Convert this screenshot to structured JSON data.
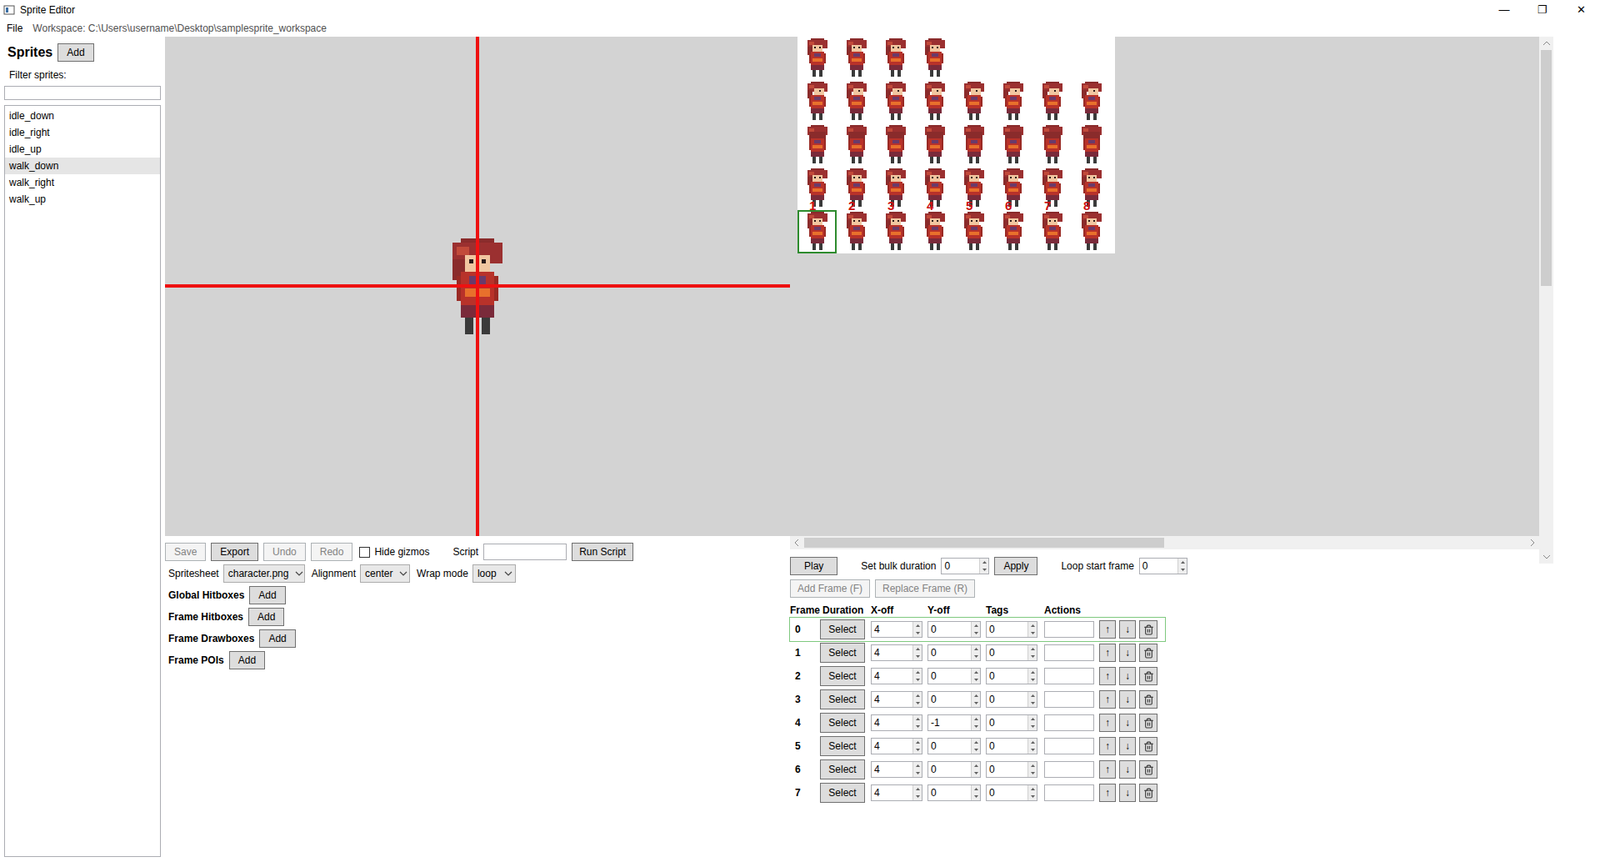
{
  "window": {
    "title": "Sprite Editor",
    "controls": [
      "—",
      "❐",
      "✕"
    ]
  },
  "menu": {
    "items": [
      "File"
    ],
    "workspace": "Workspace: C:\\Users\\username\\Desktop\\samplesprite_workspace"
  },
  "sidebar": {
    "title": "Sprites",
    "add": "Add",
    "filter_label": "Filter sprites:",
    "filter_value": "",
    "items": [
      {
        "label": "idle_down",
        "selected": false
      },
      {
        "label": "idle_right",
        "selected": false
      },
      {
        "label": "idle_up",
        "selected": false
      },
      {
        "label": "walk_down",
        "selected": true
      },
      {
        "label": "walk_right",
        "selected": false
      },
      {
        "label": "walk_up",
        "selected": false
      }
    ]
  },
  "toolbar": {
    "buttons": [
      {
        "label": "Save",
        "disabled": true
      },
      {
        "label": "Export",
        "disabled": false
      },
      {
        "label": "Undo",
        "disabled": true
      },
      {
        "label": "Redo",
        "disabled": true
      }
    ],
    "hide_gizmos": {
      "label": "Hide gizmos",
      "checked": false
    },
    "script": {
      "label": "Script",
      "value": ""
    },
    "run": "Run Script"
  },
  "settings": [
    {
      "label": "Spritesheet",
      "value": "character.png"
    },
    {
      "label": "Alignment",
      "value": "center"
    },
    {
      "label": "Wrap mode",
      "value": "loop"
    }
  ],
  "sections": [
    {
      "label": "Global Hitboxes",
      "button": "Add"
    },
    {
      "label": "Frame Hitboxes",
      "button": "Add"
    },
    {
      "label": "Frame Drawboxes",
      "button": "Add"
    },
    {
      "label": "Frame POIs",
      "button": "Add"
    }
  ],
  "sheet": {
    "rows": [
      {
        "cells": [
          {
            "label": "",
            "selected": false
          },
          {
            "label": "",
            "selected": false
          },
          {
            "label": "",
            "selected": false
          },
          {
            "label": "",
            "selected": false
          }
        ]
      },
      {
        "cells": [
          {
            "label": "",
            "selected": false
          },
          {
            "label": "",
            "selected": false
          },
          {
            "label": "",
            "selected": false
          },
          {
            "label": "",
            "selected": false
          },
          {
            "label": "",
            "selected": false
          },
          {
            "label": "",
            "selected": false
          },
          {
            "label": "",
            "selected": false
          },
          {
            "label": "",
            "selected": false
          }
        ]
      },
      {
        "cells": [
          {
            "label": "",
            "selected": false
          },
          {
            "label": "",
            "selected": false
          },
          {
            "label": "",
            "selected": false
          },
          {
            "label": "",
            "selected": false
          },
          {
            "label": "",
            "selected": false
          },
          {
            "label": "",
            "selected": false
          },
          {
            "label": "",
            "selected": false
          },
          {
            "label": "",
            "selected": false
          }
        ]
      },
      {
        "cells": [
          {
            "label": "1",
            "selected": false
          },
          {
            "label": "2",
            "selected": false
          },
          {
            "label": "3",
            "selected": false
          },
          {
            "label": "4",
            "selected": false
          },
          {
            "label": "5",
            "selected": false
          },
          {
            "label": "6",
            "selected": false
          },
          {
            "label": "7",
            "selected": false
          },
          {
            "label": "8",
            "selected": false
          }
        ]
      },
      {
        "cells": [
          {
            "label": "",
            "selected": true
          },
          {
            "label": "",
            "selected": false
          },
          {
            "label": "",
            "selected": false
          },
          {
            "label": "",
            "selected": false
          },
          {
            "label": "",
            "selected": false
          },
          {
            "label": "",
            "selected": false
          },
          {
            "label": "",
            "selected": false
          },
          {
            "label": "",
            "selected": false
          }
        ]
      }
    ]
  },
  "player": {
    "play": "Play",
    "bulk_label": "Set bulk duration",
    "bulk_value": "0",
    "apply": "Apply",
    "loop_label": "Loop start frame",
    "loop_value": "0",
    "add_frame": {
      "label": "Add Frame (F)",
      "disabled": true
    },
    "replace_frame": {
      "label": "Replace Frame (R)",
      "disabled": true
    }
  },
  "frames": {
    "columns": [
      "Frame",
      "Duration",
      "X-off",
      "Y-off",
      "Tags",
      "Actions"
    ],
    "select": "Select",
    "move_up": "↑",
    "move_down": "↓",
    "rows": [
      {
        "frame": "0",
        "duration": "4",
        "x_off": "0",
        "y_off": "0",
        "tags": "",
        "selected": true
      },
      {
        "frame": "1",
        "duration": "4",
        "x_off": "0",
        "y_off": "0",
        "tags": "",
        "selected": false
      },
      {
        "frame": "2",
        "duration": "4",
        "x_off": "0",
        "y_off": "0",
        "tags": "",
        "selected": false
      },
      {
        "frame": "3",
        "duration": "4",
        "x_off": "0",
        "y_off": "0",
        "tags": "",
        "selected": false
      },
      {
        "frame": "4",
        "duration": "4",
        "x_off": "-1",
        "y_off": "0",
        "tags": "",
        "selected": false
      },
      {
        "frame": "5",
        "duration": "4",
        "x_off": "0",
        "y_off": "0",
        "tags": "",
        "selected": false
      },
      {
        "frame": "6",
        "duration": "4",
        "x_off": "0",
        "y_off": "0",
        "tags": "",
        "selected": false
      },
      {
        "frame": "7",
        "duration": "4",
        "x_off": "0",
        "y_off": "0",
        "tags": "",
        "selected": false
      }
    ]
  }
}
